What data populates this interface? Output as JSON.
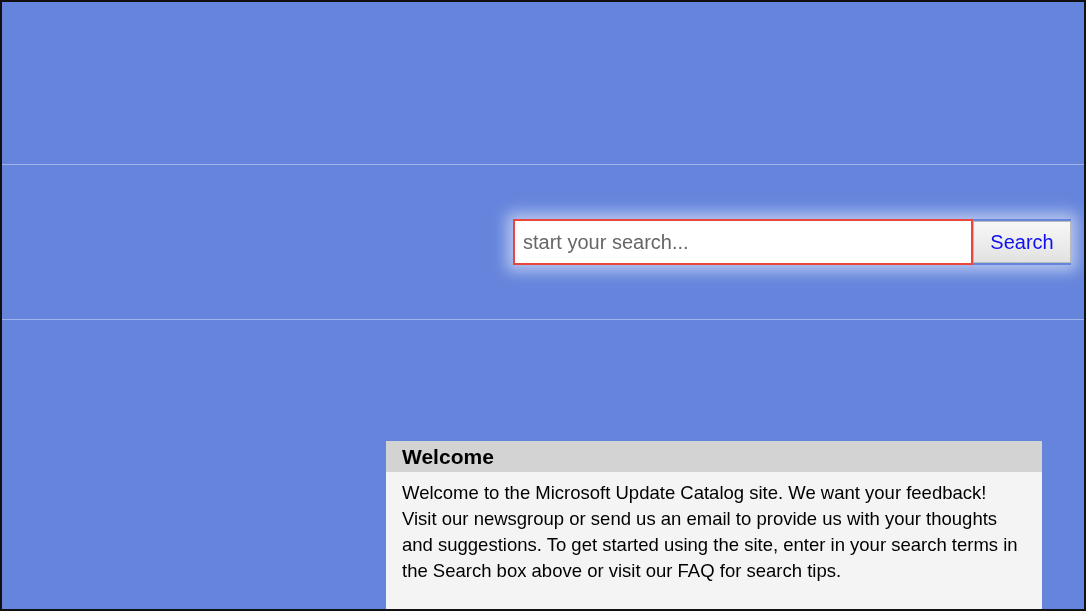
{
  "search": {
    "placeholder": "start your search...",
    "highlighted": true,
    "button": "Search"
  },
  "welcome": {
    "title": "Welcome",
    "text": "Welcome to the Microsoft Update Catalog site. We want your feedback! Visit our newsgroup or send us an email to provide us with your thoughts and suggestions. To get started using the site, enter in your search terms in the Search box above or visit our FAQ for search tips."
  }
}
